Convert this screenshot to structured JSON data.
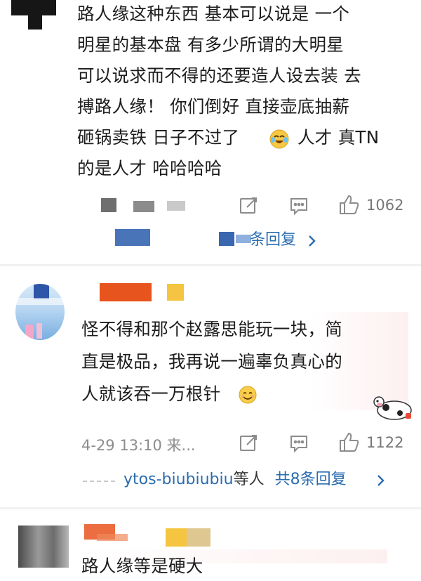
{
  "comment1": {
    "lines": [
      "路人缘这种东西 基本可以说是 一个",
      "明星的基本盘 有多少所谓的大明星",
      "可以说求而不得的还要造人设去装 去",
      "搏路人缘！ 你们倒好 直接壶底抽薪",
      "砸锅卖铁 日子不过了",
      "人才 真TN",
      "的是人才 哈哈哈哈"
    ],
    "like_count": "1062",
    "replies_link": "条回复"
  },
  "comment2": {
    "lines": [
      "怪不得和那个赵露思能玩一块，简",
      "直是极品，我再说一遍辜负真心的",
      "人就该吞一万根针"
    ],
    "timestamp": "4-29 13:10 来...",
    "like_count": "1122",
    "replies_user": "ytos-biubiubiu",
    "replies_suffix": "等人",
    "replies_count": "共8条回复"
  },
  "comment3": {
    "partial_line": "路人缘等是硬大"
  },
  "icons": {
    "share": "share-icon",
    "comment": "comment-icon",
    "like": "thumbs-up-icon",
    "chevron": "chevron-right-icon"
  },
  "colors": {
    "link": "#2b6cb0",
    "meta": "#9a9a9a",
    "name_bar": "#e8541e",
    "badge": "#f5c542"
  }
}
